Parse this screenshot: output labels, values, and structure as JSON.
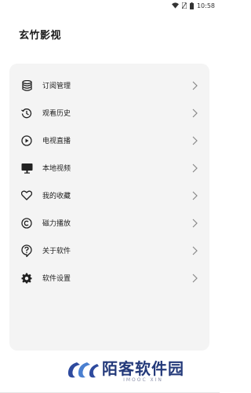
{
  "status_bar": {
    "time": "10:58"
  },
  "app": {
    "title": "玄竹影视"
  },
  "menu": {
    "items": [
      {
        "label": "订阅管理",
        "icon": "database-icon"
      },
      {
        "label": "观看历史",
        "icon": "history-icon"
      },
      {
        "label": "电视直播",
        "icon": "play-circle-icon"
      },
      {
        "label": "本地视频",
        "icon": "monitor-icon"
      },
      {
        "label": "我的收藏",
        "icon": "heart-icon"
      },
      {
        "label": "磁力播放",
        "icon": "copyright-icon"
      },
      {
        "label": "关于软件",
        "icon": "help-icon"
      },
      {
        "label": "软件设置",
        "icon": "gear-icon"
      }
    ]
  },
  "watermark": {
    "cn": "陌客软件园",
    "en": "IMOOC XIN",
    "color": "#243a7a"
  }
}
